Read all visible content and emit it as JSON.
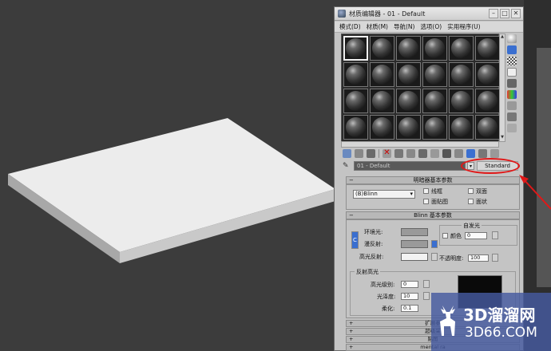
{
  "window": {
    "title": "材质编辑器 - 01 - Default",
    "min": "–",
    "max": "□",
    "close": "✕"
  },
  "menu": [
    "模式(D)",
    "材质(M)",
    "导航(N)",
    "选项(O)",
    "实用程序(U)"
  ],
  "material": {
    "name": "01 - Default",
    "type": "Standard"
  },
  "shader_basic": {
    "title": "明暗器基本参数",
    "shader": "(B)Blinn",
    "wire": "线框",
    "two_sided": "双面",
    "face_map": "面贴图",
    "faceted": "面状"
  },
  "blinn_basic": {
    "title": "Blinn 基本参数",
    "self_illum_group": "自发光",
    "color_label": "颜色",
    "color_value": "0",
    "ambient": "环境光:",
    "diffuse": "漫反射:",
    "specular": "高光反射:",
    "opacity_label": "不透明度:",
    "opacity_value": "100",
    "lock": "C"
  },
  "specular_highlights": {
    "group": "反射高光",
    "level_label": "高光级别:",
    "level_value": "0",
    "gloss_label": "光泽度:",
    "gloss_value": "10",
    "soften_label": "柔化:",
    "soften_value": "0.1"
  },
  "bottom_rollouts": [
    {
      "plus": "+",
      "label": "扩展参"
    },
    {
      "plus": "+",
      "label": "超级采"
    },
    {
      "plus": "+",
      "label": "贴图"
    },
    {
      "plus": "+",
      "label": "mental ra"
    }
  ],
  "watermark": {
    "main": "3D溜溜网",
    "sub": "3D66.COM"
  },
  "colors": {
    "highlight_red": "#e01818",
    "ambient_swatch": "#9a9a9a",
    "diffuse_swatch": "#9a9a9a",
    "specular_swatch": "#f2f2f2",
    "watermark_bg": "#465aa0"
  }
}
